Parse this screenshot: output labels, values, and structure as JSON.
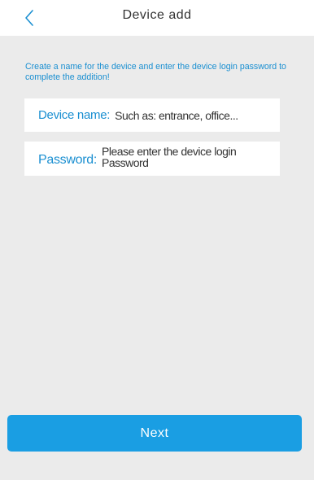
{
  "header": {
    "back_icon": "chevron-left-icon",
    "title": "Device add"
  },
  "instructions": "Create a name for the device and enter the device login password to complete the addition!",
  "fields": {
    "device_name": {
      "label": "Device name:",
      "placeholder": "Such as: entrance, office...",
      "value": ""
    },
    "password": {
      "label": "Password:",
      "placeholder": "Please enter the device login\nPassword",
      "value": ""
    }
  },
  "next_button": {
    "label": "Next"
  },
  "colors": {
    "accent": "#1a8fd1",
    "button": "#1a9ee3",
    "background": "#ebebeb",
    "surface": "#ffffff",
    "text": "#333333"
  }
}
